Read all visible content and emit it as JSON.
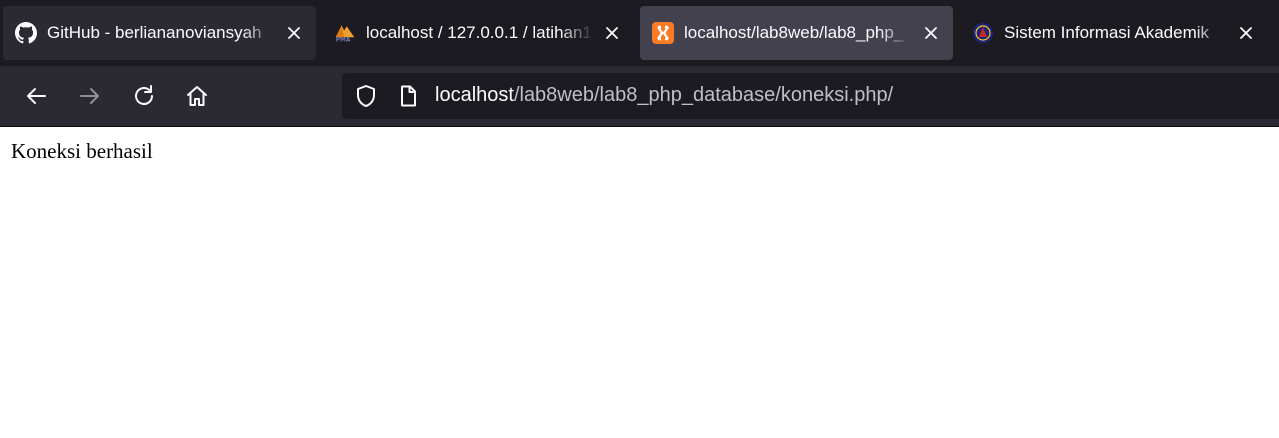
{
  "tabs": [
    {
      "title": "GitHub - berliananoviansyah",
      "icon": "github-icon",
      "selected": false
    },
    {
      "title": "localhost / 127.0.0.1 / latihan1",
      "icon": "phpmyadmin-icon",
      "selected": false
    },
    {
      "title": "localhost/lab8web/lab8_php_",
      "icon": "xampp-icon",
      "selected": true
    },
    {
      "title": "Sistem Informasi Akademik",
      "icon": "university-icon",
      "selected": false
    }
  ],
  "navigation": {
    "back_icon": "arrow-left-icon",
    "forward_icon": "arrow-right-icon",
    "reload_icon": "reload-icon",
    "home_icon": "home-icon"
  },
  "urlbar": {
    "host": "localhost",
    "path": "/lab8web/lab8_php_database/koneksi.php/"
  },
  "page": {
    "message": "Koneksi berhasil"
  },
  "colors": {
    "tabstrip": "#1c1b22",
    "toolbar": "#2b2a33",
    "selected_tab": "#42414d",
    "xampp_orange": "#fb7a24"
  }
}
